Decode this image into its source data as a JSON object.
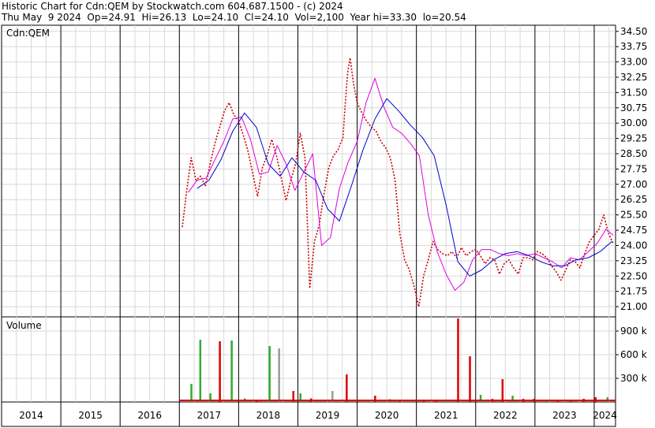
{
  "header": {
    "line1": "Historic Chart for Cdn:QEM by Stockwatch.com 604.687.1500 - (c) 2024",
    "line2": "Thu May  9 2024  Op=24.91  Hi=26.13  Lo=24.10  Cl=24.10  Vol=2,100  Year hi=33.30  lo=20.54"
  },
  "chart_data": {
    "type": "line",
    "price_label": "Cdn:QEM",
    "volume_label": "Volume",
    "x_ticks": [
      "2014",
      "2015",
      "2016",
      "2017",
      "2018",
      "2019",
      "2020",
      "2021",
      "2022",
      "2023",
      "2024"
    ],
    "y_ticks": [
      "34.50",
      "33.75",
      "33.00",
      "32.25",
      "31.50",
      "30.75",
      "30.00",
      "29.25",
      "28.50",
      "27.75",
      "27.00",
      "26.25",
      "25.50",
      "24.75",
      "24.00",
      "23.25",
      "22.50",
      "21.75",
      "21.00"
    ],
    "ylim": [
      20.5,
      34.8
    ],
    "vol_ticks": [
      "900 k",
      "600 k",
      "300 k"
    ],
    "vol_ylim": [
      0,
      1080
    ],
    "x_range": [
      2014.0,
      2024.36
    ],
    "colors": {
      "price": "#cc0000",
      "ma_short": "#e000e0",
      "ma_long": "#0000cc",
      "vol_up": "#33aa33",
      "vol_down": "#dd0000",
      "vol_flat": "#999999"
    },
    "series": [
      {
        "key": "price",
        "x": [
          2017.05,
          2017.12,
          2017.2,
          2017.28,
          2017.36,
          2017.44,
          2017.52,
          2017.6,
          2017.68,
          2017.76,
          2017.84,
          2017.92,
          2018.0,
          2018.08,
          2018.16,
          2018.24,
          2018.32,
          2018.4,
          2018.48,
          2018.56,
          2018.64,
          2018.72,
          2018.8,
          2018.88,
          2018.96,
          2019.04,
          2019.12,
          2019.2,
          2019.28,
          2019.36,
          2019.44,
          2019.52,
          2019.6,
          2019.68,
          2019.76,
          2019.8,
          2019.84,
          2019.88,
          2019.94,
          2020.0,
          2020.08,
          2020.16,
          2020.24,
          2020.32,
          2020.4,
          2020.48,
          2020.56,
          2020.64,
          2020.72,
          2020.8,
          2020.88,
          2020.96,
          2021.04,
          2021.12,
          2021.2,
          2021.28,
          2021.36,
          2021.44,
          2021.52,
          2021.6,
          2021.68,
          2021.76,
          2021.84,
          2021.92,
          2022.0,
          2022.08,
          2022.16,
          2022.24,
          2022.32,
          2022.4,
          2022.48,
          2022.56,
          2022.64,
          2022.72,
          2022.8,
          2022.88,
          2022.96,
          2023.04,
          2023.12,
          2023.2,
          2023.28,
          2023.36,
          2023.44,
          2023.52,
          2023.6,
          2023.68,
          2023.76,
          2023.84,
          2023.92,
          2024.0,
          2024.08,
          2024.16,
          2024.24,
          2024.32
        ],
        "values": [
          24.9,
          26.6,
          28.3,
          27.2,
          27.4,
          26.9,
          28.0,
          29.0,
          29.8,
          30.6,
          31.0,
          30.4,
          30.1,
          29.4,
          28.6,
          27.5,
          26.4,
          27.8,
          28.4,
          29.2,
          28.4,
          27.3,
          26.2,
          27.2,
          28.0,
          29.5,
          28.3,
          21.9,
          24.2,
          25.0,
          26.5,
          27.8,
          28.4,
          28.7,
          29.3,
          31.0,
          32.5,
          33.2,
          31.9,
          31.0,
          30.5,
          30.1,
          29.8,
          29.6,
          29.1,
          28.8,
          28.3,
          27.2,
          24.6,
          23.3,
          22.8,
          22.0,
          21.0,
          22.5,
          23.3,
          24.2,
          23.8,
          23.6,
          23.5,
          23.7,
          23.4,
          23.9,
          23.5,
          23.7,
          23.8,
          23.5,
          23.1,
          23.4,
          23.3,
          22.6,
          23.1,
          23.3,
          22.9,
          22.6,
          23.4,
          23.4,
          23.3,
          23.7,
          23.6,
          23.4,
          23.0,
          22.7,
          22.3,
          22.8,
          23.3,
          23.2,
          22.9,
          23.6,
          24.2,
          24.5,
          24.8,
          25.5,
          24.6,
          24.1
        ]
      },
      {
        "key": "ma_short",
        "x": [
          2017.15,
          2017.3,
          2017.45,
          2017.6,
          2017.75,
          2017.9,
          2018.05,
          2018.2,
          2018.35,
          2018.5,
          2018.65,
          2018.8,
          2018.95,
          2019.1,
          2019.25,
          2019.4,
          2019.55,
          2019.7,
          2019.85,
          2020.0,
          2020.15,
          2020.3,
          2020.45,
          2020.6,
          2020.75,
          2020.9,
          2021.05,
          2021.2,
          2021.35,
          2021.5,
          2021.65,
          2021.8,
          2021.95,
          2022.1,
          2022.25,
          2022.4,
          2022.55,
          2022.7,
          2022.85,
          2023.0,
          2023.15,
          2023.3,
          2023.45,
          2023.6,
          2023.75,
          2023.9,
          2024.05,
          2024.2,
          2024.32
        ],
        "values": [
          26.6,
          27.2,
          27.3,
          28.2,
          29.1,
          30.2,
          30.3,
          29.2,
          27.5,
          27.6,
          28.9,
          28.0,
          26.7,
          27.6,
          28.5,
          24.0,
          24.4,
          26.8,
          28.1,
          29.1,
          31.0,
          32.2,
          30.8,
          29.8,
          29.5,
          29.0,
          28.4,
          25.5,
          23.7,
          22.6,
          21.8,
          22.2,
          23.3,
          23.8,
          23.8,
          23.6,
          23.5,
          23.6,
          23.5,
          23.6,
          23.4,
          23.2,
          22.9,
          23.4,
          23.3,
          23.7,
          24.1,
          24.8,
          24.5
        ]
      },
      {
        "key": "ma_long",
        "x": [
          2017.3,
          2017.5,
          2017.7,
          2017.9,
          2018.1,
          2018.3,
          2018.5,
          2018.7,
          2018.9,
          2019.1,
          2019.3,
          2019.5,
          2019.7,
          2019.9,
          2020.1,
          2020.3,
          2020.5,
          2020.7,
          2020.9,
          2021.1,
          2021.3,
          2021.5,
          2021.7,
          2021.9,
          2022.1,
          2022.3,
          2022.5,
          2022.7,
          2022.9,
          2023.1,
          2023.3,
          2023.5,
          2023.7,
          2023.9,
          2024.1,
          2024.3
        ],
        "values": [
          26.8,
          27.2,
          28.2,
          29.6,
          30.5,
          29.8,
          28.0,
          27.4,
          28.3,
          27.6,
          27.2,
          25.8,
          25.2,
          26.9,
          28.7,
          30.2,
          31.2,
          30.6,
          29.9,
          29.3,
          28.4,
          26.0,
          23.2,
          22.5,
          22.8,
          23.3,
          23.6,
          23.7,
          23.5,
          23.2,
          23.0,
          23.0,
          23.3,
          23.4,
          23.7,
          24.2
        ]
      }
    ],
    "volume": {
      "x": [
        2017.2,
        2017.35,
        2017.52,
        2017.68,
        2017.88,
        2018.1,
        2018.3,
        2018.52,
        2018.68,
        2018.92,
        2019.04,
        2019.22,
        2019.38,
        2019.58,
        2019.82,
        2020.02,
        2020.3,
        2020.55,
        2020.72,
        2020.92,
        2021.12,
        2021.32,
        2021.5,
        2021.7,
        2021.9,
        2022.08,
        2022.28,
        2022.45,
        2022.62,
        2022.8,
        2022.98,
        2023.18,
        2023.38,
        2023.6,
        2023.82,
        2024.02,
        2024.22
      ],
      "values": [
        230,
        790,
        110,
        770,
        780,
        45,
        20,
        710,
        680,
        140,
        110,
        45,
        15,
        140,
        350,
        25,
        80,
        35,
        20,
        15,
        20,
        15,
        30,
        1060,
        580,
        90,
        40,
        290,
        80,
        40,
        40,
        20,
        25,
        30,
        40,
        60,
        60
      ],
      "dir": [
        "up",
        "up",
        "up",
        "down",
        "up",
        "up",
        "down",
        "up",
        "flat",
        "down",
        "up",
        "down",
        "up",
        "flat",
        "down",
        "up",
        "down",
        "up",
        "down",
        "up",
        "down",
        "down",
        "up",
        "down",
        "down",
        "up",
        "down",
        "down",
        "up",
        "down",
        "down",
        "up",
        "down",
        "down",
        "down",
        "down",
        "up"
      ]
    }
  }
}
